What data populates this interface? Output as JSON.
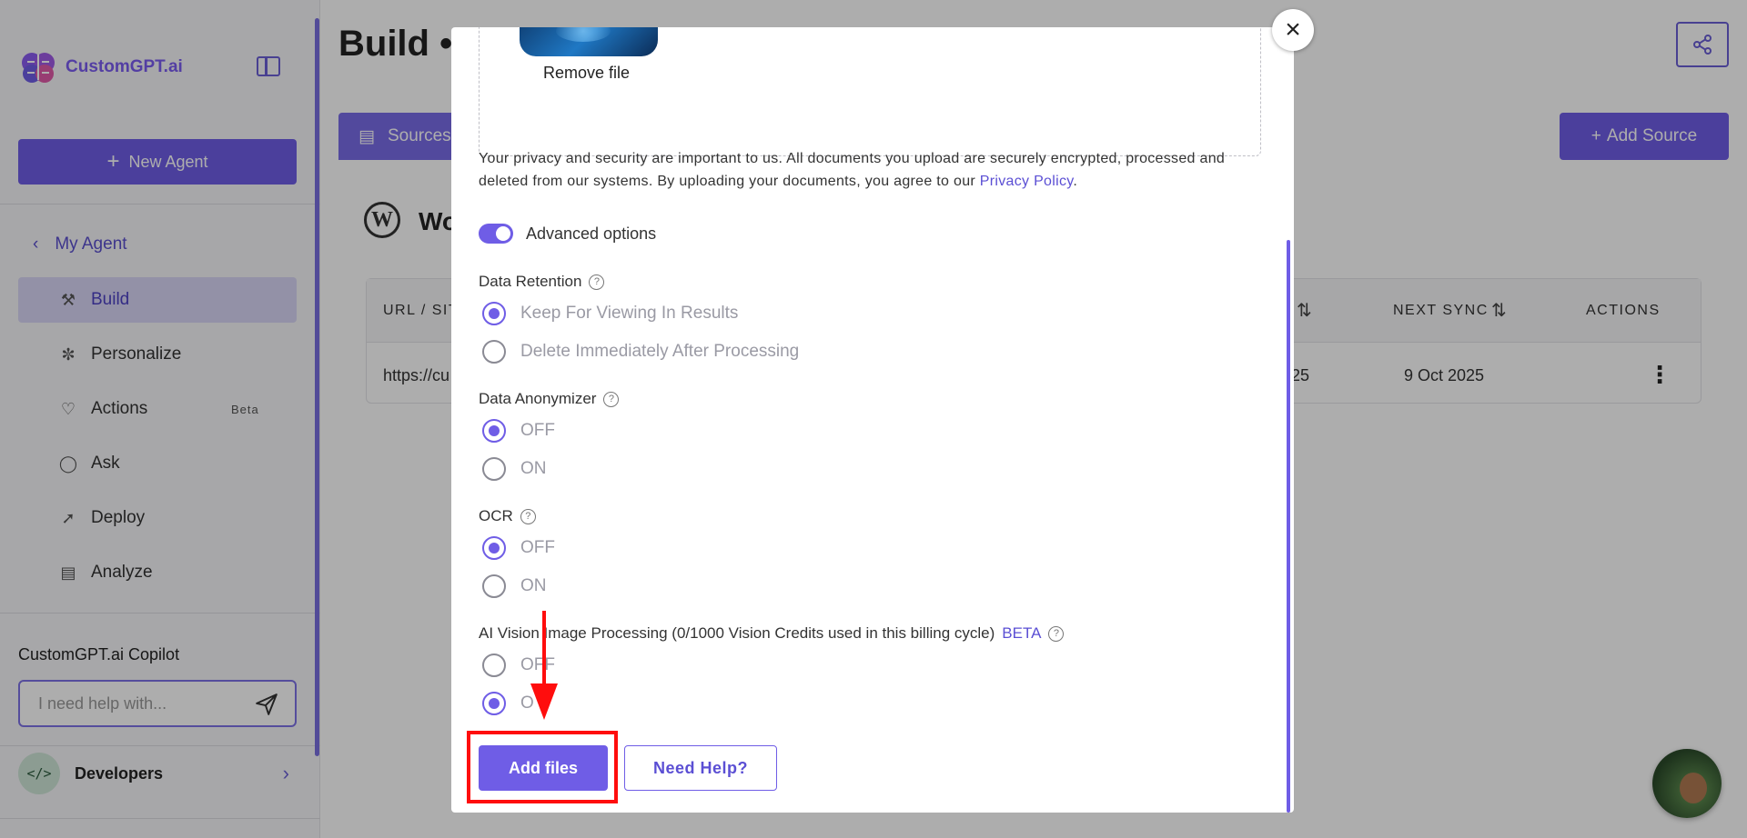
{
  "sidebar": {
    "logo_text": "CustomGPT.ai",
    "new_agent_label": "New Agent",
    "back_label": "My Agent",
    "items": [
      {
        "label": "Build",
        "icon": "build-icon",
        "active": true
      },
      {
        "label": "Personalize",
        "icon": "palette-icon"
      },
      {
        "label": "Actions",
        "icon": "actions-icon",
        "badge": "Beta"
      },
      {
        "label": "Ask",
        "icon": "chat-icon"
      },
      {
        "label": "Deploy",
        "icon": "rocket-icon"
      },
      {
        "label": "Analyze",
        "icon": "chart-icon"
      }
    ],
    "copilot_title": "CustomGPT.ai Copilot",
    "copilot_placeholder": "I need help with...",
    "developers_label": "Developers"
  },
  "main": {
    "title": "Build •",
    "sources_tab": "Sources",
    "add_source_label": "Add Source",
    "card_title": "Wo",
    "table": {
      "headers": [
        "URL / SIT",
        "NEXT SYNC",
        "ACTIONS"
      ],
      "row": {
        "url": "https://cu",
        "last_sync_fragment": "25",
        "next_sync": "9 Oct 2025"
      }
    }
  },
  "modal": {
    "remove_file_label": "Remove file",
    "privacy_text": "Your privacy and security are important to us. All documents you upload are securely encrypted, processed and deleted from our systems. By uploading your documents, you agree to our ",
    "privacy_link": "Privacy Policy",
    "privacy_end": ".",
    "advanced_label": "Advanced options",
    "sections": {
      "retention": {
        "label": "Data Retention",
        "options": [
          "Keep For Viewing In Results",
          "Delete Immediately After Processing"
        ],
        "selected": 0
      },
      "anonymizer": {
        "label": "Data Anonymizer",
        "options": [
          "OFF",
          "ON"
        ],
        "selected": 0
      },
      "ocr": {
        "label": "OCR",
        "options": [
          "OFF",
          "ON"
        ],
        "selected": 0
      },
      "vision": {
        "label": "AI Vision Image Processing (0/1000 Vision Credits used in this billing cycle)",
        "beta": "BETA",
        "options": [
          "OFF",
          "O"
        ],
        "selected": 1
      }
    },
    "add_files_label": "Add files",
    "need_help_label": "Need Help?",
    "close_symbol": "×"
  },
  "colors": {
    "accent": "#6f5de6",
    "highlight": "#ff0d0d"
  }
}
